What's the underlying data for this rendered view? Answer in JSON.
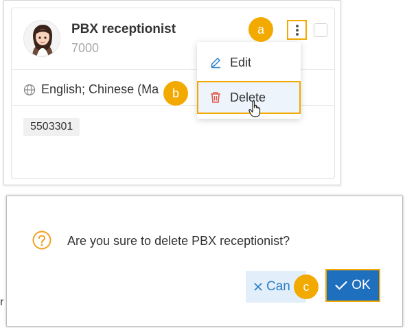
{
  "card": {
    "title": "PBX receptionist",
    "extension": "5503301",
    "ext_number": "7000",
    "languages": "English; Chinese (Ma",
    "number_tag": "5503301"
  },
  "menu": {
    "edit_label": "Edit",
    "delete_label": "Delete"
  },
  "badges": {
    "a": "a",
    "b": "b",
    "c": "c"
  },
  "dialog": {
    "message": "Are you sure to delete PBX receptionist?",
    "cancel_label": "Can",
    "ok_label": "OK"
  },
  "edge_text": "r",
  "colors": {
    "highlight": "#f2a900",
    "primary": "#1f6fbf",
    "danger": "#e05a4b",
    "edit_icon": "#2b7fc8",
    "question_icon": "#f0a020"
  },
  "icons": {
    "more": "more-vertical-icon",
    "edit": "pencil-icon",
    "delete": "trash-icon",
    "language": "globe-icon",
    "question": "question-circle-icon",
    "cancel": "close-icon",
    "ok": "check-icon"
  }
}
